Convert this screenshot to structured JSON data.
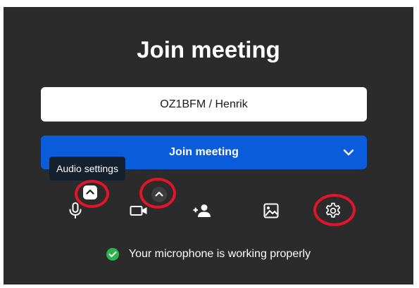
{
  "title": "Join meeting",
  "name_field": {
    "value": "OZ1BFM / Henrik"
  },
  "join_button": {
    "label": "Join meeting"
  },
  "tooltip": {
    "text": "Audio settings"
  },
  "toolbar": {
    "icons": [
      "microphone-icon",
      "chevron-up-icon",
      "camera-icon",
      "invite-person-icon",
      "image-icon",
      "gear-icon"
    ]
  },
  "status": {
    "text": "Your microphone is working properly"
  },
  "colors": {
    "panel": "#2b2b2b",
    "primary": "#0b5cdb",
    "highlight_ring": "#e0142a",
    "success": "#2cb24f"
  }
}
